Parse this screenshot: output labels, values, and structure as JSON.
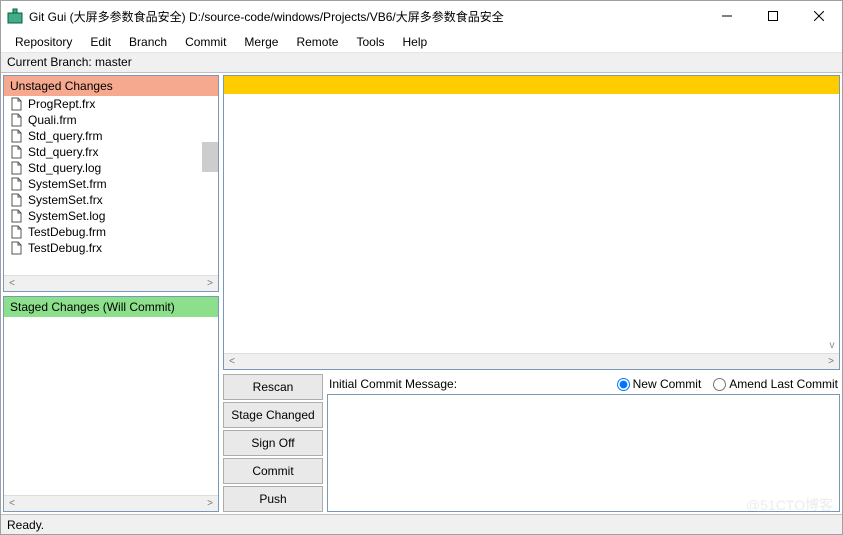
{
  "window": {
    "title": "Git Gui (大屏多参数食品安全) D:/source-code/windows/Projects/VB6/大屏多参数食品安全"
  },
  "menu": {
    "items": [
      "Repository",
      "Edit",
      "Branch",
      "Commit",
      "Merge",
      "Remote",
      "Tools",
      "Help"
    ]
  },
  "branch": {
    "label": "Current Branch: master"
  },
  "panels": {
    "unstaged_title": "Unstaged Changes",
    "staged_title": "Staged Changes (Will Commit)",
    "unstaged_files": [
      "ProgRept.frx",
      "Quali.frm",
      "Std_query.frm",
      "Std_query.frx",
      "Std_query.log",
      "SystemSet.frm",
      "SystemSet.frx",
      "SystemSet.log",
      "TestDebug.frm",
      "TestDebug.frx"
    ]
  },
  "commit": {
    "buttons": {
      "rescan": "Rescan",
      "stage": "Stage Changed",
      "signoff": "Sign Off",
      "commit": "Commit",
      "push": "Push"
    },
    "msg_label": "Initial Commit Message:",
    "radio_new": "New Commit",
    "radio_amend": "Amend Last Commit",
    "selected_radio": "new"
  },
  "status": {
    "text": "Ready."
  },
  "watermark": "@51CTO博客"
}
